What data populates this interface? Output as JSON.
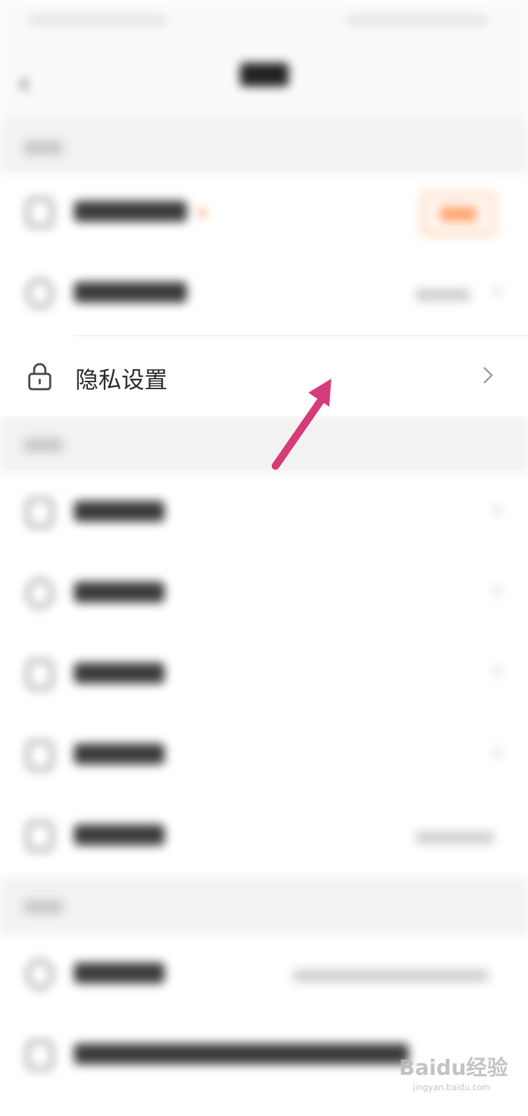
{
  "privacy_row": {
    "label": "隐私设置"
  },
  "watermark": {
    "brand": "Baidu经验",
    "url": "jingyan.baidu.com"
  },
  "colors": {
    "arrow": "#d63b7a",
    "accent_orange": "#ff7a3a",
    "section_bg": "#f2f2f2"
  },
  "icons": {
    "back": "chevron-left-icon",
    "privacy": "lock-icon",
    "row_chevron": "chevron-right-icon"
  }
}
